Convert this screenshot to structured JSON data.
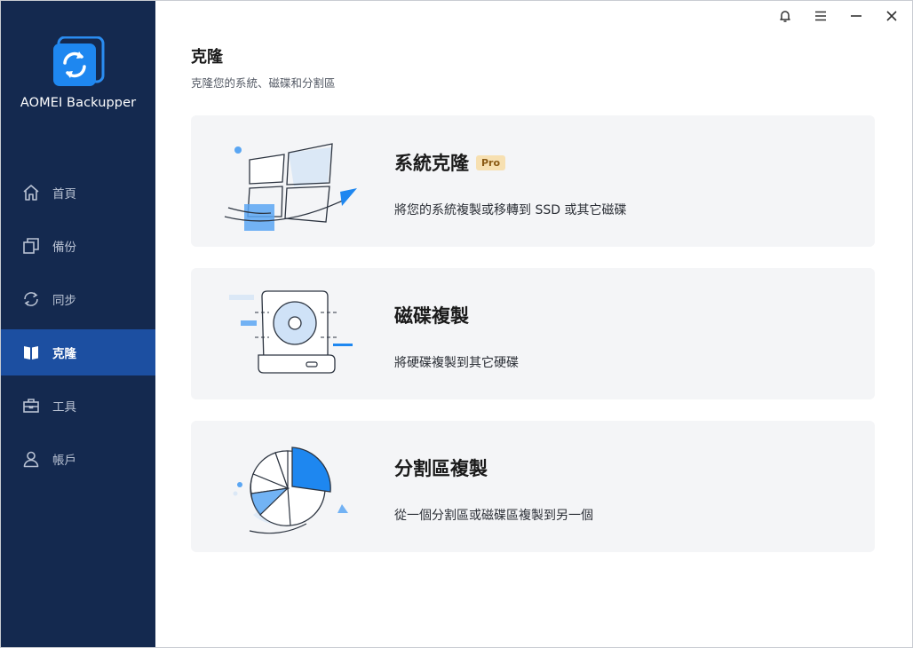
{
  "app": {
    "name": "AOMEI Backupper"
  },
  "colors": {
    "sidebar": "#14294f",
    "active": "#1c4fa1",
    "accent": "#1e87f0",
    "card": "#f4f5f7",
    "pro_badge": "#f7e0b1"
  },
  "titlebar": {
    "icons": [
      "bell-icon",
      "menu-icon",
      "minimize-icon",
      "close-icon"
    ]
  },
  "sidebar": {
    "items": [
      {
        "label": "首頁",
        "icon": "home-icon",
        "active": false
      },
      {
        "label": "備份",
        "icon": "backup-icon",
        "active": false
      },
      {
        "label": "同步",
        "icon": "sync-icon",
        "active": false
      },
      {
        "label": "克隆",
        "icon": "clone-icon",
        "active": true
      },
      {
        "label": "工具",
        "icon": "toolbox-icon",
        "active": false
      },
      {
        "label": "帳戶",
        "icon": "user-icon",
        "active": false
      }
    ]
  },
  "header": {
    "title": "克隆",
    "subtitle": "克隆您的系統、磁碟和分割區"
  },
  "cards": [
    {
      "title": "系統克隆",
      "badge": "Pro",
      "desc": "將您的系統複製或移轉到 SSD 或其它磁碟",
      "icon": "system-clone-illustration"
    },
    {
      "title": "磁碟複製",
      "desc": "將硬碟複製到其它硬碟",
      "icon": "disk-clone-illustration"
    },
    {
      "title": "分割區複製",
      "desc": "從一個分割區或磁碟區複製到另一個",
      "icon": "partition-clone-illustration"
    }
  ]
}
